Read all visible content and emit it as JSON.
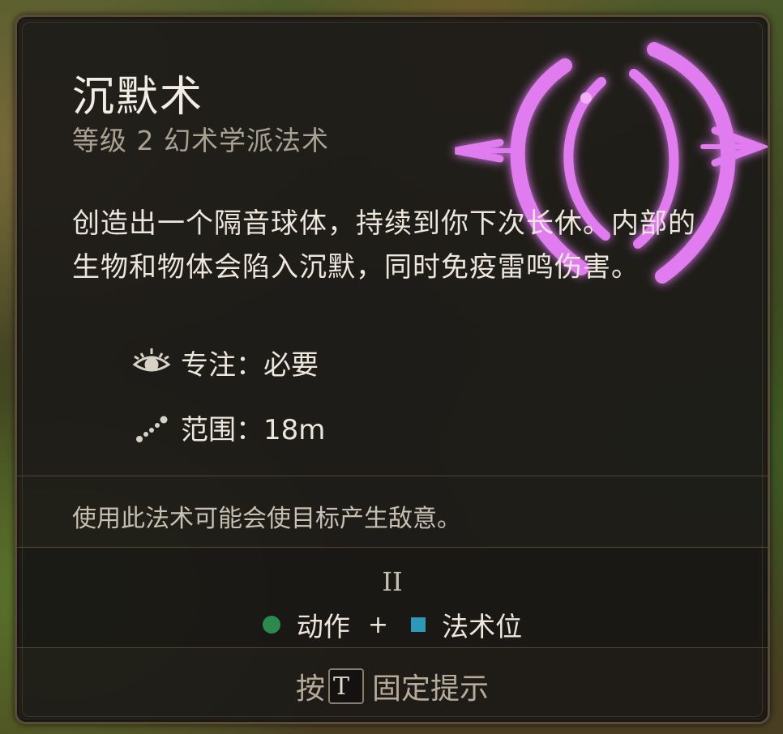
{
  "spell": {
    "name": "沉默术",
    "subtitle": "等级 2 幻术学派法术",
    "description": "创造出一个隔音球体，持续到你下次长休。内部的生物和物体会陷入沉默，同时免疫雷鸣伤害。",
    "icon": "silence-spell-icon",
    "icon_color": "#d46ae6"
  },
  "properties": [
    {
      "icon": "concentration-eye-icon",
      "label": "专注：必要"
    },
    {
      "icon": "range-dotted-line-icon",
      "label": "范围：18m"
    }
  ],
  "warning": "使用此法术可能会使目标产生敌意。",
  "cost": {
    "level_roman": "II",
    "action_label": "动作",
    "plus": "+",
    "slot_label": "法术位",
    "action_color": "#2d8a4e",
    "slot_color": "#2a9ab8"
  },
  "hint": {
    "prefix": "按",
    "key": "T",
    "suffix": "固定提示"
  }
}
